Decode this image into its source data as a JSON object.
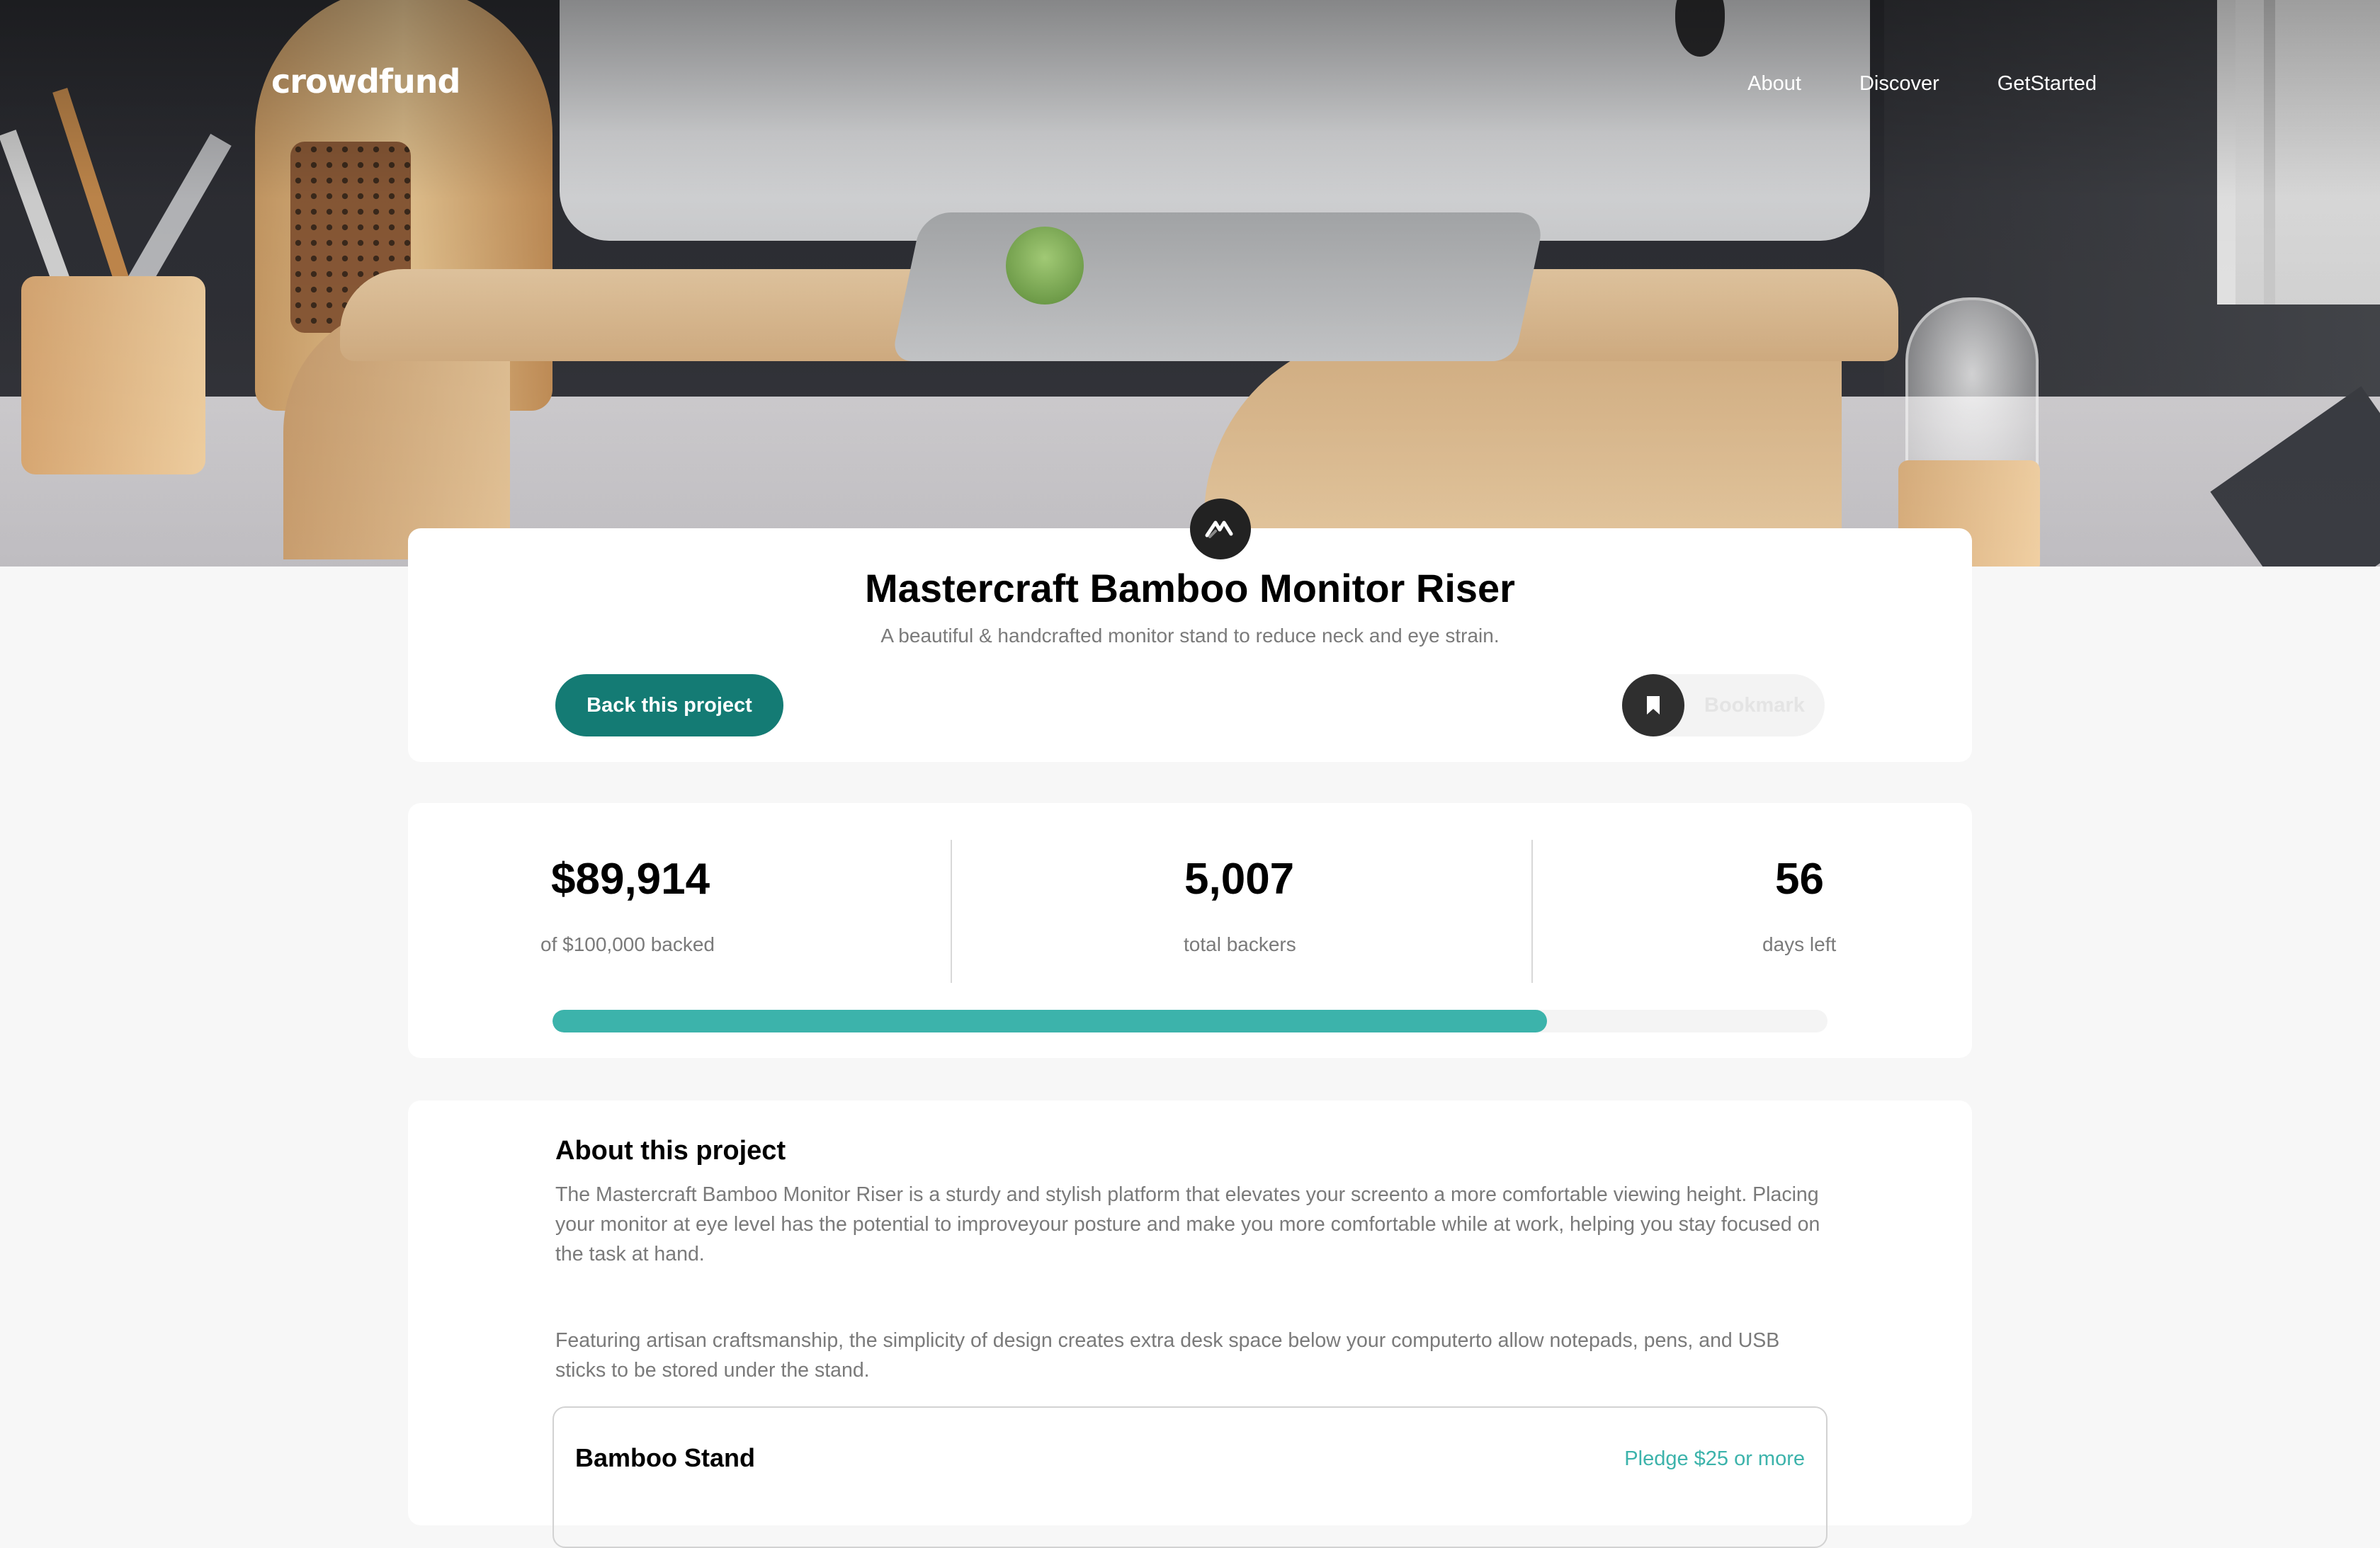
{
  "header": {
    "logo": "crowdfund",
    "nav": [
      "About",
      "Discover",
      "GetStarted"
    ]
  },
  "project": {
    "title": "Mastercraft Bamboo Monitor Riser",
    "subtitle": "A beautiful & handcrafted monitor stand to reduce neck and eye strain.",
    "back_label": "Back this project",
    "bookmark_label": "Bookmark"
  },
  "stats": {
    "backed_amount": "$89,914",
    "backed_label": "of $100,000 backed",
    "backers_count": "5,007",
    "backers_label": "total backers",
    "days_count": "56",
    "days_label": "days left",
    "progress_fraction": 0.78
  },
  "about": {
    "heading": "About this project",
    "paragraph1": "The Mastercraft Bamboo Monitor Riser is a sturdy and stylish platform that elevates your screento a more comfortable viewing height. Placing your monitor at eye level has the potential to improveyour posture and make you more comfortable while at work, helping you stay focused on the task at hand.",
    "paragraph2": "Featuring artisan craftsmanship, the simplicity of design creates extra desk space below your computerto allow notepads, pens, and USB sticks to be stored under the stand."
  },
  "rewards": [
    {
      "title": "Bamboo Stand",
      "pledge": "Pledge $25 or more"
    }
  ],
  "colors": {
    "primary_dark": "#147b74",
    "primary": "#3cb3ab",
    "text_muted": "#7a7a7a"
  },
  "icons": {
    "brand": "mastercraft-logo-icon",
    "bookmark": "bookmark-icon"
  }
}
